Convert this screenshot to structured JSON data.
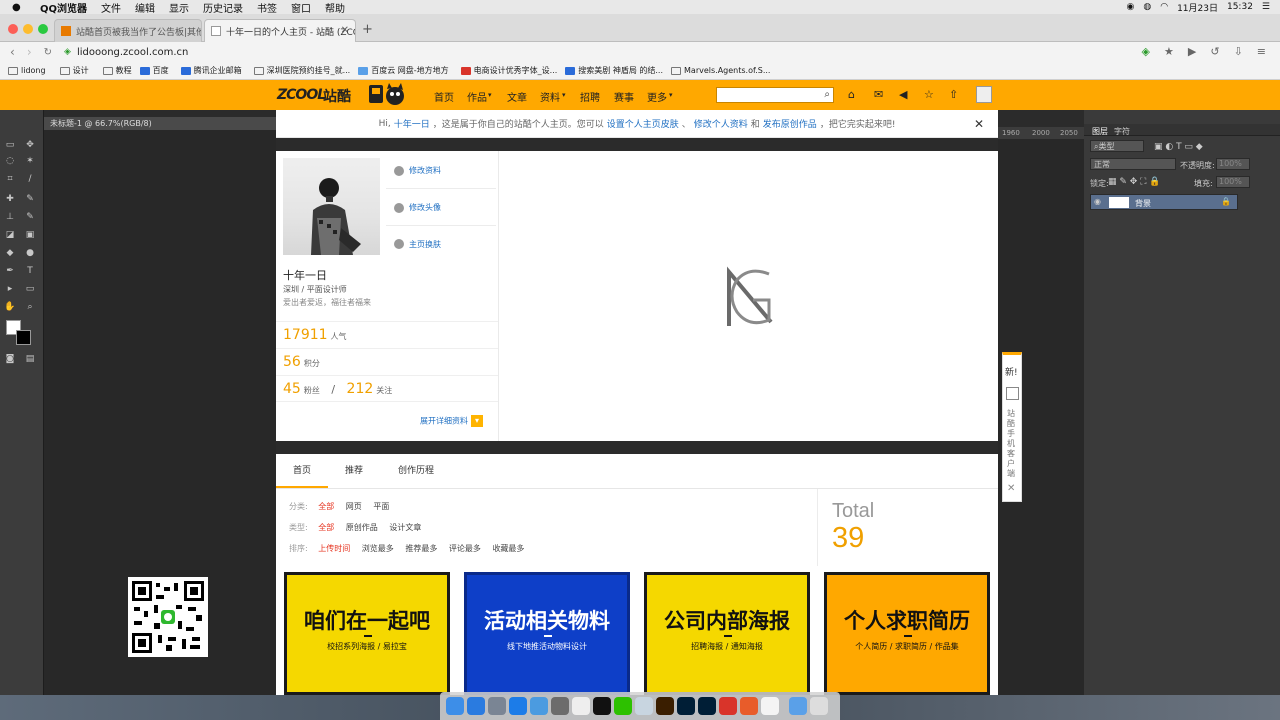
{
  "menubar": {
    "items": [
      "QQ浏览器",
      "文件",
      "编辑",
      "显示",
      "历史记录",
      "书签",
      "窗口",
      "帮助"
    ],
    "date": "11月23日",
    "time": "15:32"
  },
  "tabs": [
    {
      "title": "站酷首页被我当作了公告板|其他...",
      "active": false
    },
    {
      "title": "十年一日的个人主页 - 站酷 (ZCO...",
      "active": true
    }
  ],
  "address": {
    "url": "lidooong.zcool.com.cn"
  },
  "bookmarks": [
    "lidong",
    "设计",
    "教程",
    "百度",
    "腾讯企业邮箱",
    "深圳医院预约挂号_就...",
    "百度云 网盘-地方地方",
    "电商设计优秀字体_设...",
    "搜索美剧 神盾局 的结...",
    "Marvels.Agents.of.S..."
  ],
  "zcool": {
    "logo_en": "ZCOOL",
    "logo_cn": "站酷",
    "nav": [
      "首页",
      "作品",
      "文章",
      "资料",
      "招聘",
      "赛事",
      "更多"
    ],
    "search_placeholder": ""
  },
  "photoshop": {
    "doc_tab": "未标题-1 @ 66.7%(RGB/8)",
    "ruler_ticks": [
      "1960",
      "2000",
      "2050"
    ],
    "panel_tabs": [
      "图层",
      "字符"
    ],
    "kind_label": "类型",
    "blend_mode": "正常",
    "opacity_label": "不透明度:",
    "opacity_value": "100%",
    "lock_label": "锁定:",
    "fill_label": "填充:",
    "fill_value": "100%",
    "layer_name": "背景"
  },
  "notice": {
    "prefix": "Hi,",
    "name": "十年一日",
    "middle": "，这是属于你自己的站酷个人主页。您可以",
    "link1": "设置个人主页皮肤",
    "sep": "、",
    "link2": "修改个人资料",
    "and": "和",
    "link3": "发布原创作品",
    "suffix": "，把它完实起来吧!"
  },
  "profile": {
    "actions": [
      "修改资料",
      "修改头像",
      "主页换肤"
    ],
    "name": "十年一日",
    "city": "深圳 / 平面设计师",
    "signature": "爱出者爱返，福往者福来",
    "popularity": "17911",
    "popularity_unit": "人气",
    "points": "56",
    "points_unit": "积分",
    "fans": "45",
    "fans_unit": "粉丝",
    "slash": "/",
    "follows": "212",
    "follows_unit": "关注",
    "expand": "展开详细资料"
  },
  "content": {
    "tabs": [
      "首页",
      "推荐",
      "创作历程"
    ],
    "filters": [
      {
        "label": "分类:",
        "options": [
          "全部",
          "网页",
          "平面"
        ]
      },
      {
        "label": "类型:",
        "options": [
          "全部",
          "原创作品",
          "设计文章"
        ]
      },
      {
        "label": "排序:",
        "options": [
          "上传时间",
          "浏览最多",
          "推荐最多",
          "评论最多",
          "收藏最多"
        ]
      }
    ],
    "total_label": "Total",
    "total": "39",
    "cards": [
      {
        "title": "咱们在一起吧",
        "sub": "校招系列海报 / 易拉宝",
        "bg": "#f5d800",
        "border": "#1a1a1a",
        "fg": "#111"
      },
      {
        "title": "活动相关物料",
        "sub": "线下地推活动物料设计",
        "bg": "#0e3fc8",
        "border": "#0a2a8a",
        "fg": "#fff"
      },
      {
        "title": "公司内部海报",
        "sub": "招聘海报 / 通知海报",
        "bg": "#f5d800",
        "border": "#1a1a1a",
        "fg": "#111"
      },
      {
        "title": "个人求职简历",
        "sub": "个人简历 / 求职简历 / 作品集",
        "bg": "#ffa800",
        "border": "#1a1a1a",
        "fg": "#111"
      }
    ]
  },
  "sidefloat": {
    "new": "新!",
    "text": "站酷手机客户端",
    "close": "✕"
  },
  "colors": {
    "zcool_orange": "#ffa800",
    "link_blue": "#1f6fc2",
    "stat_orange": "#f0a000",
    "filter_red": "#e6321e"
  }
}
